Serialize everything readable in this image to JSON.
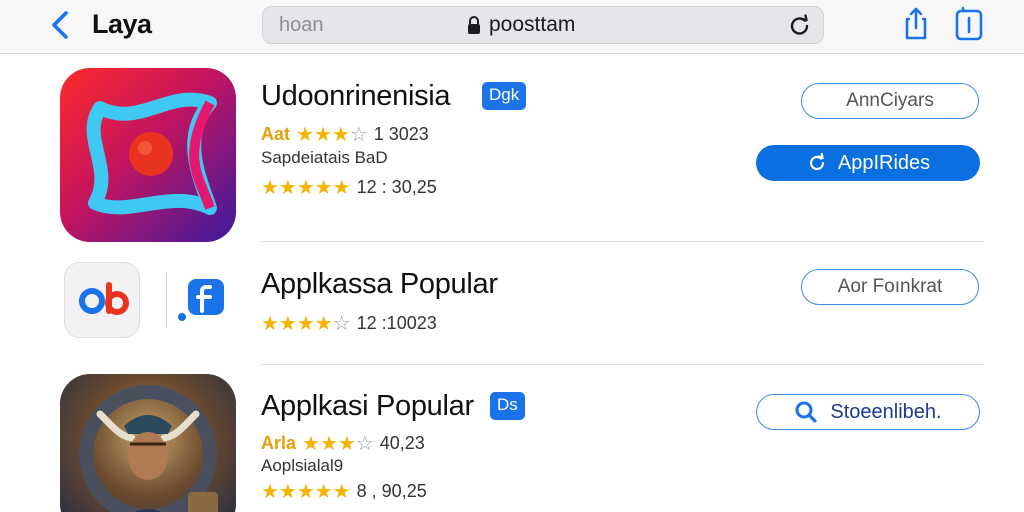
{
  "header": {
    "back_label": "Laya",
    "url_left": "hoan",
    "url_main": "poosttam"
  },
  "apps": [
    {
      "title": "Udoonrinenisia",
      "badge": "Dgk",
      "rating_prefix": "Aat",
      "rating_stars": 3.5,
      "rating_text": "1 3023",
      "subtitle": "Sapdeiatais BaD",
      "rating2_stars": 5,
      "rating2_text": "12 : 30,25",
      "button_outline": "AnnCiyars",
      "button_primary": "AppIRides"
    },
    {
      "title": "Applkassa Popular",
      "rating_stars": 4.5,
      "rating_text": "12 :10023",
      "button_outline": "Aor Foınkrat",
      "side_label": "ob"
    },
    {
      "title": "Applkasi Popular",
      "badge": "Ds",
      "rating_prefix": "Arla",
      "rating_stars": 3.5,
      "rating_text": "40,23",
      "subtitle": "Aoplsialal9",
      "rating2_stars": 5,
      "rating2_text": "8 , 90,25",
      "button_search": "Stoeenlibeh."
    }
  ]
}
